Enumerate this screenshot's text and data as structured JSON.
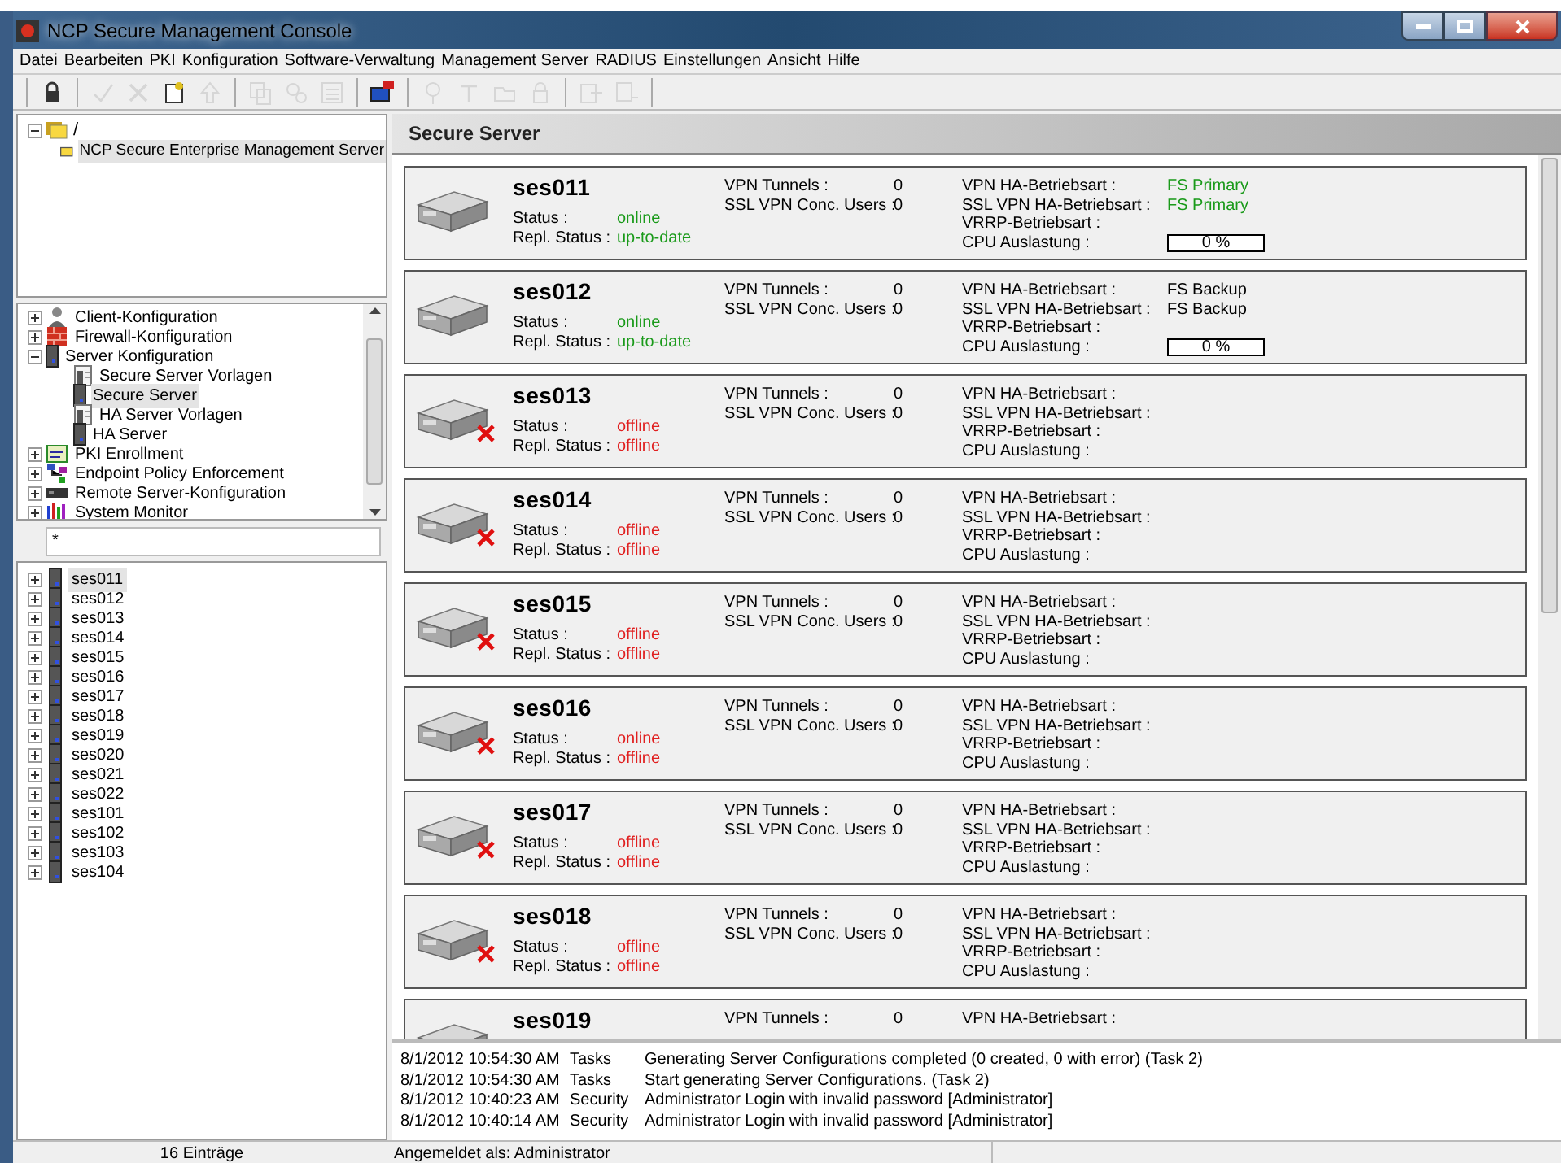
{
  "window": {
    "title": "NCP Secure Management Console"
  },
  "menu": [
    "Datei",
    "Bearbeiten",
    "PKI",
    "Konfiguration",
    "Software-Verwaltung",
    "Management Server",
    "RADIUS",
    "Einstellungen",
    "Ansicht",
    "Hilfe"
  ],
  "toolbar": [
    {
      "kind": "separator"
    },
    {
      "kind": "button",
      "disabled": false
    },
    {
      "kind": "separator"
    },
    {
      "kind": "button",
      "disabled": true
    },
    {
      "kind": "button",
      "disabled": true
    },
    {
      "kind": "button",
      "disabled": false
    },
    {
      "kind": "button",
      "disabled": true
    },
    {
      "kind": "separator"
    },
    {
      "kind": "button",
      "disabled": true
    },
    {
      "kind": "button",
      "disabled": true
    },
    {
      "kind": "button",
      "disabled": true
    },
    {
      "kind": "separator"
    },
    {
      "kind": "button",
      "disabled": false
    },
    {
      "kind": "separator"
    },
    {
      "kind": "button",
      "disabled": true
    },
    {
      "kind": "button",
      "disabled": true
    },
    {
      "kind": "button",
      "disabled": true
    },
    {
      "kind": "button",
      "disabled": true
    },
    {
      "kind": "separator"
    },
    {
      "kind": "button",
      "disabled": true
    },
    {
      "kind": "button",
      "disabled": true
    },
    {
      "kind": "separator"
    }
  ],
  "root_tree": [
    {
      "label": "/",
      "expanded": true,
      "selected": false,
      "children": [
        {
          "label": "NCP Secure Enterprise Management Server",
          "selected": true
        }
      ]
    }
  ],
  "nav_tree": [
    {
      "label": "Client-Konfiguration",
      "expanded": false,
      "selected": false
    },
    {
      "label": "Firewall-Konfiguration",
      "expanded": false,
      "selected": false
    },
    {
      "label": "Server Konfiguration",
      "expanded": true,
      "selected": false,
      "children": [
        {
          "label": "Secure Server Vorlagen",
          "selected": false
        },
        {
          "label": "Secure Server",
          "selected": true
        },
        {
          "label": "HA Server Vorlagen",
          "selected": false
        },
        {
          "label": "HA Server",
          "selected": false
        }
      ]
    },
    {
      "label": "PKI Enrollment",
      "expanded": false,
      "selected": false
    },
    {
      "label": "Endpoint Policy Enforcement",
      "expanded": false,
      "selected": false
    },
    {
      "label": "Remote Server-Konfiguration",
      "expanded": false,
      "selected": false
    },
    {
      "label": "System Monitor",
      "expanded": false,
      "selected": false
    }
  ],
  "filter": {
    "value": "*"
  },
  "server_list": [
    {
      "label": "ses011",
      "selected": true
    },
    {
      "label": "ses012",
      "selected": false
    },
    {
      "label": "ses013",
      "selected": false
    },
    {
      "label": "ses014",
      "selected": false
    },
    {
      "label": "ses015",
      "selected": false
    },
    {
      "label": "ses016",
      "selected": false
    },
    {
      "label": "ses017",
      "selected": false
    },
    {
      "label": "ses018",
      "selected": false
    },
    {
      "label": "ses019",
      "selected": false
    },
    {
      "label": "ses020",
      "selected": false
    },
    {
      "label": "ses021",
      "selected": false
    },
    {
      "label": "ses022",
      "selected": false
    },
    {
      "label": "ses101",
      "selected": false
    },
    {
      "label": "ses102",
      "selected": false
    },
    {
      "label": "ses103",
      "selected": false
    },
    {
      "label": "ses104",
      "selected": false
    }
  ],
  "panel": {
    "title": "Secure Server"
  },
  "servers": [
    {
      "name": "ses011",
      "online": true,
      "status_rows": [
        {
          "label": "Status :",
          "value": "online"
        },
        {
          "label": "Repl. Status :",
          "value": "up-to-date"
        }
      ],
      "metrics": [
        {
          "label": "VPN Tunnels :",
          "value": "0"
        },
        {
          "label": "SSL VPN Conc. Users :",
          "value": "0"
        }
      ],
      "ha": [
        {
          "label": "VPN HA-Betriebsart :",
          "value": "FS Primary",
          "highlight": true
        },
        {
          "label": "SSL VPN HA-Betriebsart :",
          "value": "FS Primary",
          "highlight": true
        },
        {
          "label": "VRRP-Betriebsart :"
        }
      ],
      "cpu": {
        "label": "CPU Auslastung :",
        "value": "0 %"
      }
    },
    {
      "name": "ses012",
      "online": true,
      "status_rows": [
        {
          "label": "Status :",
          "value": "online"
        },
        {
          "label": "Repl. Status :",
          "value": "up-to-date"
        }
      ],
      "metrics": [
        {
          "label": "VPN Tunnels :",
          "value": "0"
        },
        {
          "label": "SSL VPN Conc. Users :",
          "value": "0"
        }
      ],
      "ha": [
        {
          "label": "VPN HA-Betriebsart :",
          "value": "FS Backup",
          "highlight": false
        },
        {
          "label": "SSL VPN HA-Betriebsart :",
          "value": "FS Backup",
          "highlight": false
        },
        {
          "label": "VRRP-Betriebsart :"
        }
      ],
      "cpu": {
        "label": "CPU Auslastung :",
        "value": "0 %"
      }
    },
    {
      "name": "ses013",
      "online": false,
      "status_rows": [
        {
          "label": "Status :",
          "value": "offline"
        },
        {
          "label": "Repl. Status :",
          "value": "offline"
        }
      ],
      "metrics": [
        {
          "label": "VPN Tunnels :",
          "value": "0"
        },
        {
          "label": "SSL VPN Conc. Users :",
          "value": "0"
        }
      ],
      "ha": [
        {
          "label": "VPN HA-Betriebsart :"
        },
        {
          "label": "SSL VPN HA-Betriebsart :"
        },
        {
          "label": "VRRP-Betriebsart :"
        }
      ],
      "cpu": {
        "label": "CPU Auslastung :"
      }
    },
    {
      "name": "ses014",
      "online": false,
      "status_rows": [
        {
          "label": "Status :",
          "value": "offline"
        },
        {
          "label": "Repl. Status :",
          "value": "offline"
        }
      ],
      "metrics": [
        {
          "label": "VPN Tunnels :",
          "value": "0"
        },
        {
          "label": "SSL VPN Conc. Users :",
          "value": "0"
        }
      ],
      "ha": [
        {
          "label": "VPN HA-Betriebsart :"
        },
        {
          "label": "SSL VPN HA-Betriebsart :"
        },
        {
          "label": "VRRP-Betriebsart :"
        }
      ],
      "cpu": {
        "label": "CPU Auslastung :"
      }
    },
    {
      "name": "ses015",
      "online": false,
      "status_rows": [
        {
          "label": "Status :",
          "value": "offline"
        },
        {
          "label": "Repl. Status :",
          "value": "offline"
        }
      ],
      "metrics": [
        {
          "label": "VPN Tunnels :",
          "value": "0"
        },
        {
          "label": "SSL VPN Conc. Users :",
          "value": "0"
        }
      ],
      "ha": [
        {
          "label": "VPN HA-Betriebsart :"
        },
        {
          "label": "SSL VPN HA-Betriebsart :"
        },
        {
          "label": "VRRP-Betriebsart :"
        }
      ],
      "cpu": {
        "label": "CPU Auslastung :"
      }
    },
    {
      "name": "ses016",
      "online": false,
      "status_rows": [
        {
          "label": "Status :",
          "value": "online"
        },
        {
          "label": "Repl. Status :",
          "value": "offline"
        }
      ],
      "metrics": [
        {
          "label": "VPN Tunnels :",
          "value": "0"
        },
        {
          "label": "SSL VPN Conc. Users :",
          "value": "0"
        }
      ],
      "ha": [
        {
          "label": "VPN HA-Betriebsart :"
        },
        {
          "label": "SSL VPN HA-Betriebsart :"
        },
        {
          "label": "VRRP-Betriebsart :"
        }
      ],
      "cpu": {
        "label": "CPU Auslastung :"
      }
    },
    {
      "name": "ses017",
      "online": false,
      "status_rows": [
        {
          "label": "Status :",
          "value": "offline"
        },
        {
          "label": "Repl. Status :",
          "value": "offline"
        }
      ],
      "metrics": [
        {
          "label": "VPN Tunnels :",
          "value": "0"
        },
        {
          "label": "SSL VPN Conc. Users :",
          "value": "0"
        }
      ],
      "ha": [
        {
          "label": "VPN HA-Betriebsart :"
        },
        {
          "label": "SSL VPN HA-Betriebsart :"
        },
        {
          "label": "VRRP-Betriebsart :"
        }
      ],
      "cpu": {
        "label": "CPU Auslastung :"
      }
    },
    {
      "name": "ses018",
      "online": false,
      "status_rows": [
        {
          "label": "Status :",
          "value": "offline"
        },
        {
          "label": "Repl. Status :",
          "value": "offline"
        }
      ],
      "metrics": [
        {
          "label": "VPN Tunnels :",
          "value": "0"
        },
        {
          "label": "SSL VPN Conc. Users :",
          "value": "0"
        }
      ],
      "ha": [
        {
          "label": "VPN HA-Betriebsart :"
        },
        {
          "label": "SSL VPN HA-Betriebsart :"
        },
        {
          "label": "VRRP-Betriebsart :"
        }
      ],
      "cpu": {
        "label": "CPU Auslastung :"
      }
    },
    {
      "name": "ses019",
      "metrics": [
        {
          "label": "VPN Tunnels :",
          "value": "0"
        }
      ],
      "ha": [
        {
          "label": "VPN HA-Betriebsart :"
        }
      ]
    }
  ],
  "log": [
    {
      "time": "8/1/2012 10:54:30 AM",
      "category": "Tasks",
      "message": "Generating Server Configurations completed (0 created, 0 with error) (Task 2)"
    },
    {
      "time": "8/1/2012 10:54:30 AM",
      "category": "Tasks",
      "message": "Start generating Server Configurations. (Task 2)"
    },
    {
      "time": "8/1/2012 10:40:23 AM",
      "category": "Security",
      "message": "Administrator Login with invalid password [Administrator]"
    },
    {
      "time": "8/1/2012 10:40:14 AM",
      "category": "Security",
      "message": "Administrator Login with invalid password [Administrator]"
    }
  ],
  "status_bar": {
    "count": "16 Einträge",
    "user": "Angemeldet als: Administrator"
  }
}
